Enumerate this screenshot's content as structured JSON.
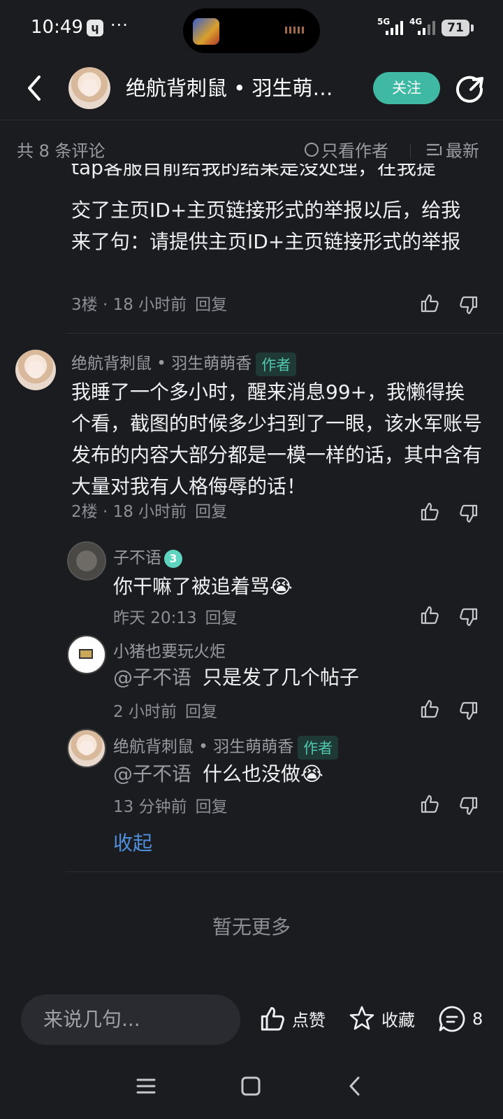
{
  "status_bar": {
    "time": "10:49",
    "app_icon": "ɥ",
    "dots": "···",
    "net1": "5G",
    "net2": "4G",
    "battery": "71"
  },
  "header": {
    "title": "绝航背刺鼠 • 羽生萌萌香",
    "follow_label": "关注"
  },
  "filter": {
    "count_label": "共 8 条评论",
    "author_only_label": "只看作者",
    "sort_label": "最新"
  },
  "comments": [
    {
      "partial_line": "tap客服目前给我的结果是没处理，在我提",
      "text": "交了主页ID+主页链接形式的举报以后，给我来了句：请提供主页ID+主页链接形式的举报",
      "floor": "3楼",
      "time": "18 小时前",
      "reply_label": "回复"
    },
    {
      "username": "绝航背刺鼠 • 羽生萌萌香",
      "badge": "作者",
      "text": "我睡了一个多小时，醒来消息99+，我懒得挨个看，截图的时候多少扫到了一眼，该水军账号发布的内容大部分都是一模一样的话，其中含有大量对我有人格侮辱的话！",
      "floor": "2楼",
      "time": "18 小时前",
      "reply_label": "回复",
      "replies": [
        {
          "username": "子不语",
          "level": "3",
          "text": "你干嘛了被追着骂😭",
          "time": "昨天 20:13",
          "reply_label": "回复"
        },
        {
          "username": "小猪也要玩火炬",
          "mention": "@子不语",
          "text": "只是发了几个帖子",
          "time": "2 小时前",
          "reply_label": "回复"
        },
        {
          "username": "绝航背刺鼠 • 羽生萌萌香",
          "badge": "作者",
          "mention": "@子不语",
          "text": "什么也没做😭",
          "time": "13 分钟前",
          "reply_label": "回复"
        }
      ],
      "collapse_label": "收起"
    }
  ],
  "no_more_label": "暂无更多",
  "bottom_bar": {
    "input_placeholder": "来说几句...",
    "like_label": "点赞",
    "favorite_label": "收藏",
    "comment_count": "8"
  },
  "colors": {
    "background": "#1b1c20",
    "accent": "#3fb9a3",
    "link": "#4f8fdb"
  }
}
